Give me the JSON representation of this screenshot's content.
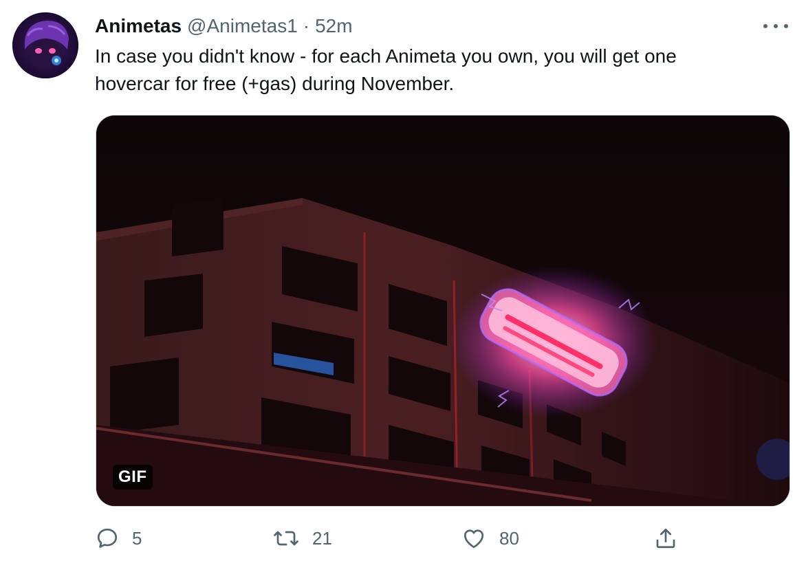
{
  "tweet": {
    "display_name": "Animetas",
    "handle": "@Animetas1",
    "separator": "·",
    "time": "52m",
    "text": "In case you didn't know - for each Animeta you own, you will get one\nhovercar for free (+gas) during November.",
    "media_badge": "GIF",
    "avatar_icon": "animetas-avatar",
    "more_icon": "more-horizontal-icon"
  },
  "actions": {
    "reply": {
      "icon": "reply-icon",
      "count": "5"
    },
    "retweet": {
      "icon": "retweet-icon",
      "count": "21"
    },
    "like": {
      "icon": "heart-icon",
      "count": "80"
    },
    "share": {
      "icon": "share-icon"
    }
  },
  "colors": {
    "text_primary": "#0f1419",
    "text_secondary": "#536471",
    "border": "#cfd9de",
    "hovercar_glow": "#ff4fa8"
  }
}
